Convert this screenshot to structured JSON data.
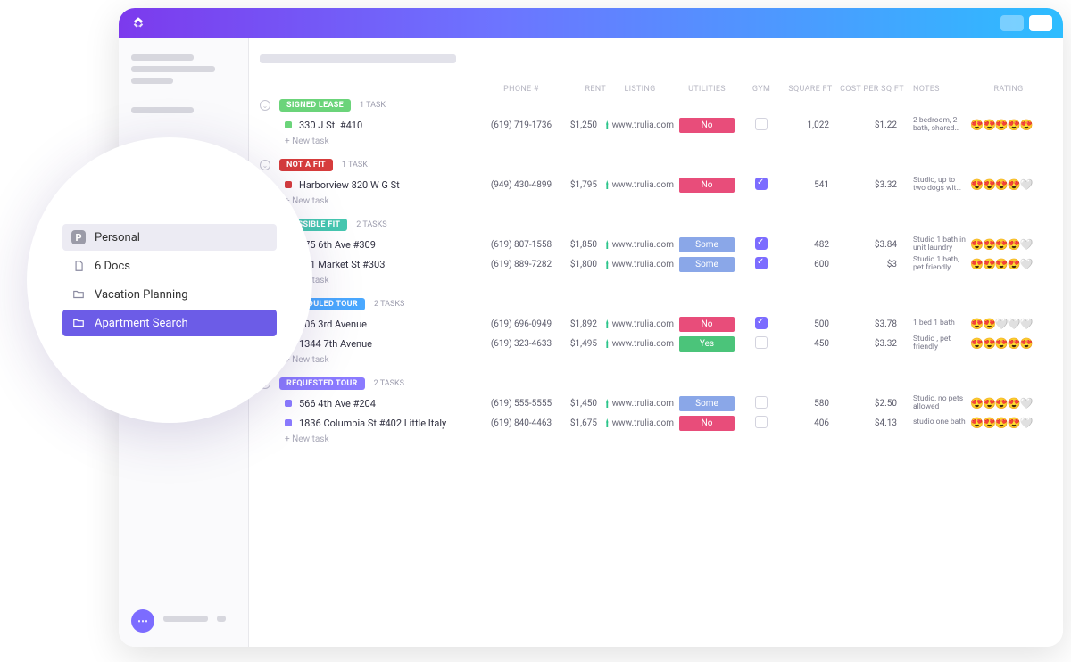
{
  "app": {
    "logo": "clickup"
  },
  "sidebar_popout": {
    "space": "Personal",
    "space_initial": "P",
    "docs_label": "6 Docs",
    "folders": [
      {
        "label": "Vacation Planning",
        "selected": false
      },
      {
        "label": "Apartment Search",
        "selected": true
      }
    ]
  },
  "columns": {
    "phone": "PHONE #",
    "rent": "RENT",
    "listing": "LISTING",
    "utilities": "UTILITIES",
    "gym": "GYM",
    "sqft": "SQUARE FT",
    "cost": "COST PER SQ FT",
    "notes": "NOTES",
    "rating": "RATING"
  },
  "listing_text": "www.trulia.com",
  "new_task_label": "+ New task",
  "groups": [
    {
      "status": "SIGNED LEASE",
      "status_color": "#6bd47a",
      "task_count": "1 TASK",
      "rows": [
        {
          "sq": "#6bd47a",
          "title": "330 J St. #410",
          "phone": "(619) 719-1736",
          "rent": "$1,250",
          "utilities": "No",
          "util_class": "util-no",
          "gym": false,
          "sqft": "1,022",
          "cost": "$1.22",
          "notes": "2 bedroom, 2 bath, shared…",
          "rating": "😍😍😍😍😍"
        }
      ]
    },
    {
      "status": "NOT A FIT",
      "status_color": "#d63c3c",
      "task_count": "1 TASK",
      "rows": [
        {
          "sq": "#d63c3c",
          "title": "Harborview 820 W G St",
          "phone": "(949) 430-4899",
          "rent": "$1,795",
          "utilities": "No",
          "util_class": "util-no",
          "gym": true,
          "sqft": "541",
          "cost": "$3.32",
          "notes": "Studio, up to two dogs wit…",
          "rating": "😍😍😍😍🤍"
        }
      ]
    },
    {
      "status": "POSSIBLE FIT",
      "status_color": "#46c7b0",
      "task_count": "2 TASKS",
      "rows": [
        {
          "sq": "#46c7b0",
          "title": "575 6th Ave #309",
          "phone": "(619) 807-1558",
          "rent": "$1,850",
          "utilities": "Some",
          "util_class": "util-some",
          "gym": true,
          "sqft": "482",
          "cost": "$3.84",
          "notes": "Studio 1 bath in unit laundry",
          "rating": "😍😍😍😍🤍"
        },
        {
          "sq": "#46c7b0",
          "title": "101 Market St #303",
          "phone": "(619) 889-7282",
          "rent": "$1,800",
          "utilities": "Some",
          "util_class": "util-some",
          "gym": true,
          "sqft": "600",
          "cost": "$3",
          "notes": "Studio 1 bath, pet friendly",
          "rating": "😍😍😍😍🤍"
        }
      ]
    },
    {
      "status": "SCHEDULED TOUR",
      "status_color": "#4aa8ff",
      "task_count": "2 TASKS",
      "rows": [
        {
          "sq": "#4aa8ff",
          "title": "606 3rd Avenue",
          "phone": "(619) 696-0949",
          "rent": "$1,892",
          "utilities": "No",
          "util_class": "util-no",
          "gym": true,
          "sqft": "500",
          "cost": "$3.78",
          "notes": "1 bed 1 bath",
          "rating": "😍😍🤍🤍🤍"
        },
        {
          "sq": "#4aa8ff",
          "title": "1344 7th Avenue",
          "phone": "(619) 323-4633",
          "rent": "$1,495",
          "utilities": "Yes",
          "util_class": "util-yes",
          "gym": false,
          "sqft": "450",
          "cost": "$3.32",
          "notes": "Studio , pet friendly",
          "rating": "😍😍😍😍😍"
        }
      ]
    },
    {
      "status": "REQUESTED TOUR",
      "status_color": "#8b7bff",
      "task_count": "2 TASKS",
      "rows": [
        {
          "sq": "#8b7bff",
          "title": "566 4th Ave #204",
          "phone": "(619) 555-5555",
          "rent": "$1,450",
          "utilities": "Some",
          "util_class": "util-some",
          "gym": false,
          "sqft": "580",
          "cost": "$2.50",
          "notes": "Studio, no pets allowed",
          "rating": "😍😍😍😍🤍"
        },
        {
          "sq": "#8b7bff",
          "title": "1836 Columbia St #402 Little Italy",
          "phone": "(619) 840-4463",
          "rent": "$1,675",
          "utilities": "No",
          "util_class": "util-no",
          "gym": false,
          "sqft": "406",
          "cost": "$4.13",
          "notes": "studio one bath",
          "rating": "😍😍😍😍🤍"
        }
      ]
    }
  ]
}
